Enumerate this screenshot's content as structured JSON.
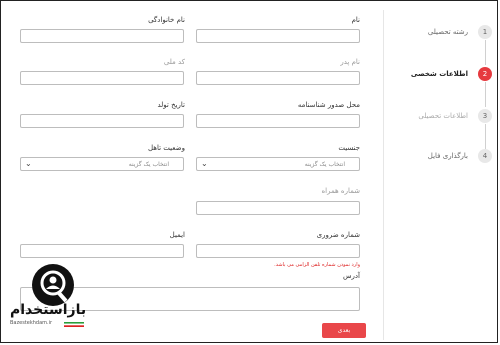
{
  "steps": [
    {
      "num": "1",
      "label": "رشته تحصیلی"
    },
    {
      "num": "2",
      "label": "اطلاعات شخصی"
    },
    {
      "num": "3",
      "label": "اطلاعات تحصیلی"
    },
    {
      "num": "4",
      "label": "بارگذاری فایل"
    }
  ],
  "form": {
    "first_name_label": "نام",
    "last_name_label": "نام خانوادگی",
    "father_name_label": "نام پدر",
    "national_code_label": "کد ملی",
    "issue_place_label": "محل صدور شناسنامه",
    "birth_date_label": "تاریخ تولد",
    "gender_label": "جنسیت",
    "gender_value": "انتخاب یک گزینه",
    "marital_label": "وضعیت تاهل",
    "marital_value": "انتخاب یک گزینه",
    "phone_label": "شماره همراه",
    "emergency_label": "شماره ضروری",
    "email_label": "ایمیل",
    "error_text": "وارد نمودن شماره تلفن الزامی می باشد.",
    "address_label": "آدرس",
    "submit_label": "بعدی"
  },
  "watermark": {
    "text": "بازاستخدام",
    "sub": "Bazestekhdam.ir"
  }
}
